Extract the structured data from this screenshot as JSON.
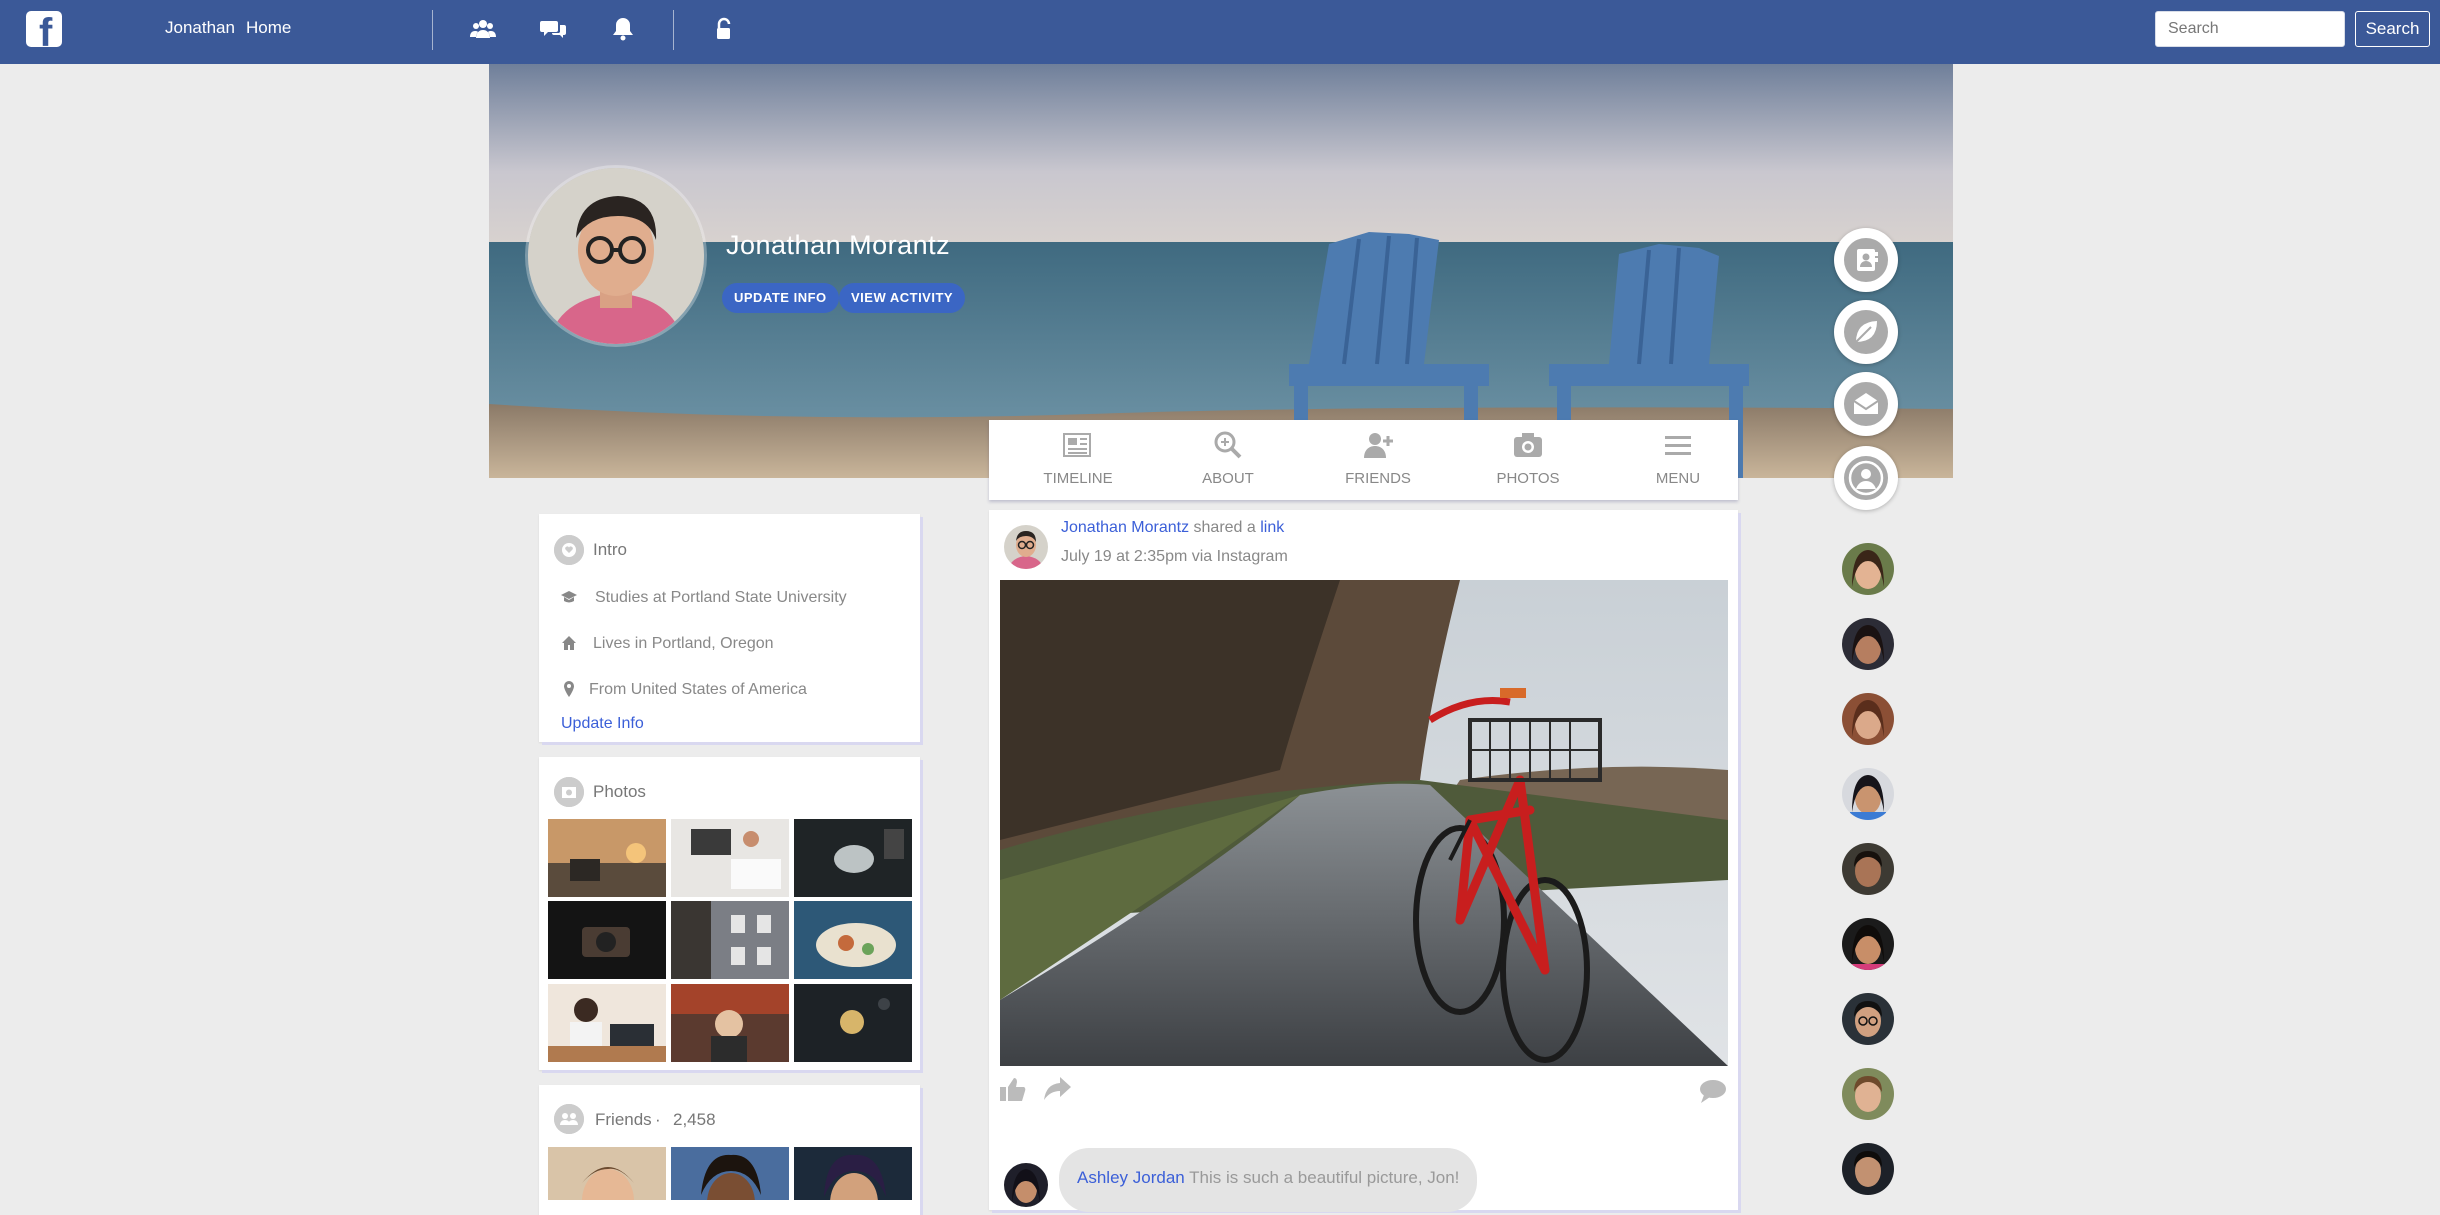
{
  "topbar": {
    "logo": "facebook-logo",
    "user_link": "Jonathan",
    "home_link": "Home",
    "icons": [
      "friends-icon",
      "messages-icon",
      "notifications-icon",
      "lock-icon"
    ],
    "search_placeholder": "Search",
    "search_button": "Search",
    "color": "#3b5998"
  },
  "profile": {
    "name": "Jonathan Morantz",
    "update_info_button": "UPDATE INFO",
    "view_activity_button": "VIEW ACTIVITY"
  },
  "side_buttons": [
    "contacts-icon",
    "leaf-icon",
    "mail-icon",
    "user-icon"
  ],
  "tabs": [
    {
      "label": "TIMELINE",
      "icon": "newspaper-icon"
    },
    {
      "label": "ABOUT",
      "icon": "search-icon"
    },
    {
      "label": "FRIENDS",
      "icon": "add-friend-icon"
    },
    {
      "label": "PHOTOS",
      "icon": "camera-icon"
    },
    {
      "label": "MENU",
      "icon": "menu-icon"
    }
  ],
  "intro": {
    "title": "Intro",
    "items": [
      {
        "icon": "graduation-cap-icon",
        "text": "Studies at Portland State University"
      },
      {
        "icon": "home-icon",
        "text": "Lives in Portland, Oregon"
      },
      {
        "icon": "map-pin-icon",
        "text": "From United States of America"
      }
    ],
    "update_link": "Update Info"
  },
  "photos": {
    "title": "Photos"
  },
  "friends": {
    "title": "Friends",
    "separator": "·",
    "count": "2,458"
  },
  "post": {
    "author": "Jonathan Morantz",
    "shared_text": "shared a",
    "link_text": "link",
    "timestamp": "July 19 at 2:35pm via Instagram"
  },
  "comment": {
    "author": "Ashley Jordan",
    "text": "This is such a beautiful picture, Jon!"
  },
  "accent_link_color": "#3b5fd8"
}
